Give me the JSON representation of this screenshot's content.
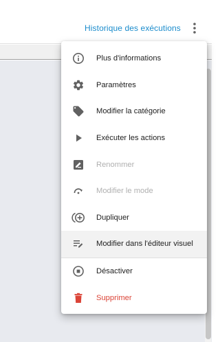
{
  "header": {
    "history_link": "Historique des exécutions"
  },
  "menu": {
    "items": [
      {
        "label": "Plus d'informations",
        "icon": "info-icon",
        "state": "normal"
      },
      {
        "label": "Paramètres",
        "icon": "gear-icon",
        "state": "normal"
      },
      {
        "label": "Modifier la catégorie",
        "icon": "tag-icon",
        "state": "normal"
      },
      {
        "label": "Exécuter les actions",
        "icon": "play-icon",
        "state": "normal"
      },
      {
        "label": "Renommer",
        "icon": "rename-icon",
        "state": "disabled"
      },
      {
        "label": "Modifier le mode",
        "icon": "mode-icon",
        "state": "disabled"
      },
      {
        "label": "Dupliquer",
        "icon": "duplicate-icon",
        "state": "normal"
      },
      {
        "label": "Modifier dans l'éditeur visuel",
        "icon": "edit-text-icon",
        "state": "highlighted"
      },
      {
        "label": "Désactiver",
        "icon": "stop-circle-icon",
        "state": "normal"
      },
      {
        "label": "Supprimer",
        "icon": "trash-icon",
        "state": "danger"
      }
    ]
  },
  "colors": {
    "link": "#1b8ccc",
    "icon": "#616161",
    "disabled": "#b0b0b0",
    "danger": "#db4437",
    "highlight": "#f2f2f2"
  }
}
